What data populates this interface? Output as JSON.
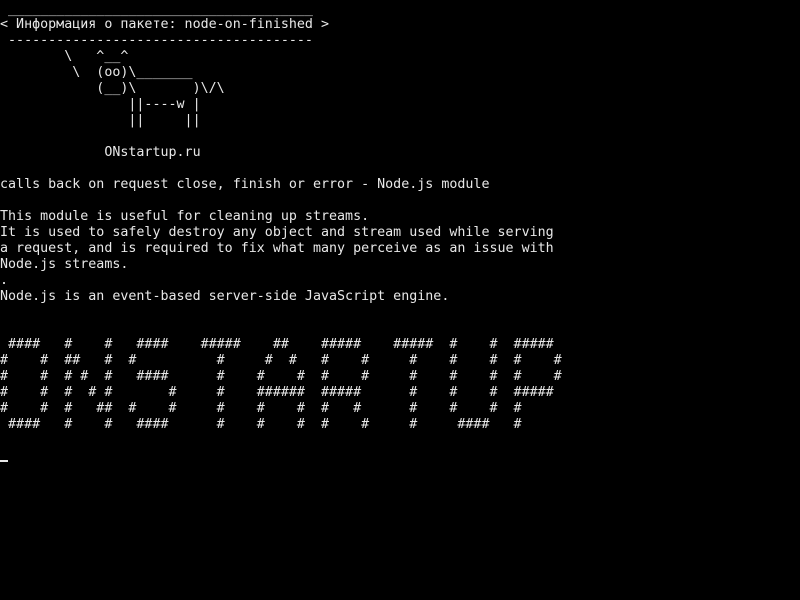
{
  "terminal": {
    "speech_bubble": {
      "top_border": " ______________________________________",
      "text": "< Информация о пакете: node-on-finished >",
      "bottom_border": " --------------------------------------"
    },
    "cow": [
      "        \\   ^__^",
      "         \\  (oo)\\_______",
      "            (__)\\       )\\/\\",
      "                ||----w |",
      "                ||     ||"
    ],
    "site": "             ONstartup.ru",
    "summary": "calls back on request close, finish or error - Node.js module",
    "description": [
      "This module is useful for cleaning up streams.",
      "It is used to safely destroy any object and stream used while serving",
      "a request, and is required to fix what many perceive as an issue with",
      "Node.js streams.",
      ".",
      "Node.js is an event-based server-side JavaScript engine."
    ],
    "banner": [
      " ####   #    #   ####    #####    ##    #####    #####  #    #  #####",
      "#    #  ##   #  #          #     #  #   #    #     #    #    #  #    #",
      "#    #  # #  #   ####      #    #    #  #    #     #    #    #  #    #",
      "#    #  #  # #       #     #    ######  #####      #    #    #  #####",
      "#    #  #   ##  #    #     #    #    #  #   #      #    #    #  #",
      " ####   #    #   ####      #    #    #  #    #     #     ####   #"
    ]
  }
}
